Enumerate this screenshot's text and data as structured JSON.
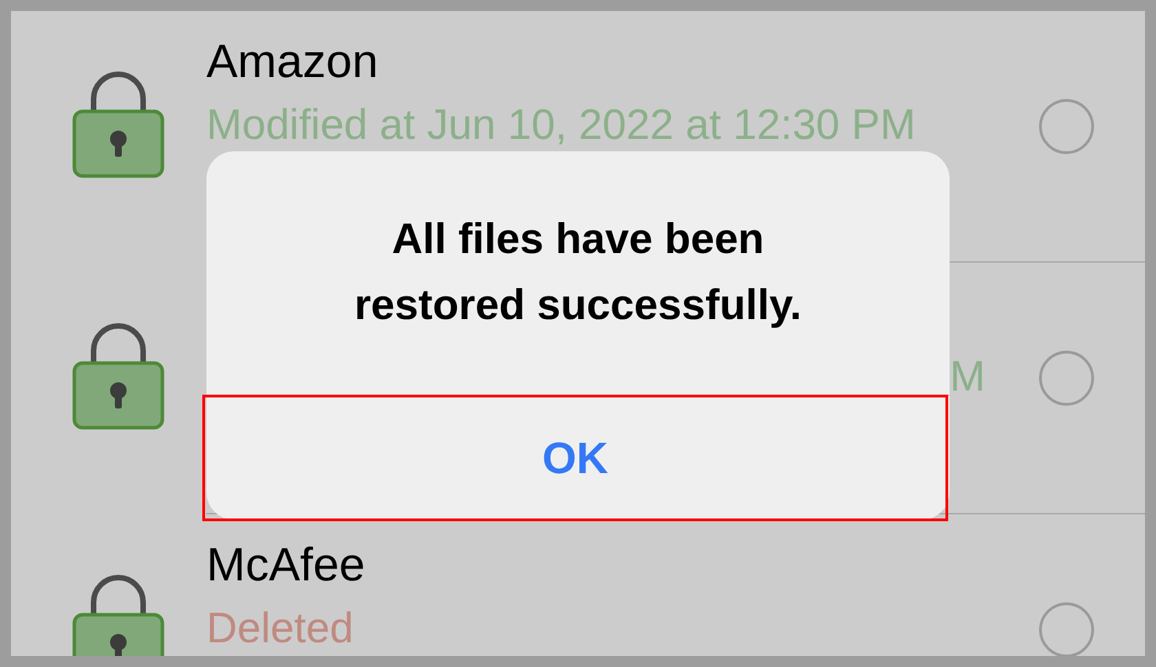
{
  "rows": [
    {
      "kind": "full",
      "title": "Amazon",
      "subtitle": "Modified at Jun 10, 2022 at 12:30 PM",
      "color": "#8cb08a",
      "selected": false
    },
    {
      "kind": "covered",
      "subtitle": "M",
      "color": "#8cb08a",
      "selected": false
    },
    {
      "kind": "full",
      "title": "McAfee",
      "subtitle": "Deleted",
      "color": "#c08a80",
      "selected": false
    }
  ],
  "alert": {
    "message": "All files have been restored successfully.",
    "button": {
      "label": "OK",
      "highlighted": true
    }
  }
}
